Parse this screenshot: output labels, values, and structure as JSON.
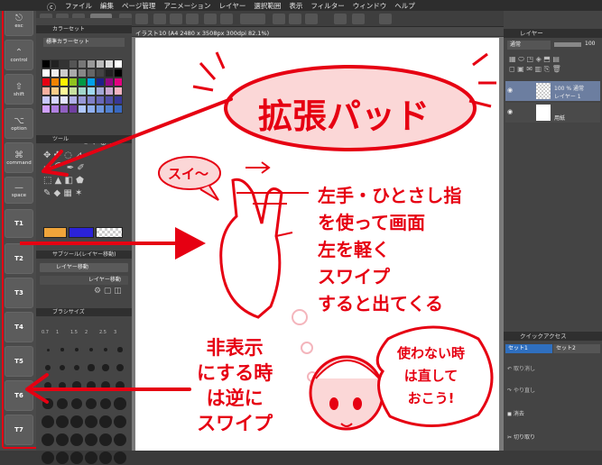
{
  "menubar": {
    "items": [
      "ファイル",
      "編集",
      "ページ管理",
      "アニメーション",
      "レイヤー",
      "選択範囲",
      "表示",
      "フィルター",
      "ウィンドウ",
      "ヘルプ"
    ]
  },
  "pad": {
    "buttons": [
      {
        "icon": "⎋",
        "label": "esc"
      },
      {
        "icon": "⌃",
        "label": "control"
      },
      {
        "icon": "⇧",
        "label": "shift"
      },
      {
        "icon": "⌥",
        "label": "option"
      },
      {
        "icon": "⌘",
        "label": "command"
      },
      {
        "icon": "—",
        "label": "space"
      },
      {
        "icon": "",
        "label": "T1"
      },
      {
        "icon": "",
        "label": "T2"
      },
      {
        "icon": "",
        "label": "T3"
      },
      {
        "icon": "",
        "label": "T4"
      },
      {
        "icon": "",
        "label": "T5"
      },
      {
        "icon": "",
        "label": "T6"
      },
      {
        "icon": "",
        "label": "T7"
      }
    ]
  },
  "palettes": {
    "color_set_tab": "カラーセット",
    "color_set_name": "標準カラーセット",
    "tool_tab": "ツール",
    "subtool_tab": "サブツール(レイヤー移動)",
    "subtool_item1": "レイヤー移動",
    "subtool_item2": "レイヤー移動",
    "brush_size_tab": "ブラシサイズ",
    "brush_sizes": [
      "0.7",
      "1",
      "1.5",
      "2",
      "2.5",
      "3"
    ]
  },
  "document": {
    "tab_title": "イラスト10 (A4 2480 x 3508px 300dpi 82.1%)"
  },
  "layers": {
    "panel_title": "レイヤー",
    "blend_mode": "通常",
    "opacity": "100",
    "layer1_meta": "100 % 通常",
    "layer1_name": "レイヤー 1",
    "paper_name": "用紙"
  },
  "quick_access": {
    "panel_title": "クイックアクセス",
    "tab1": "セット1",
    "tab2": "セット2",
    "items": [
      "取り消し",
      "やり直し",
      "消去",
      "切り取り"
    ]
  },
  "annotations": {
    "title": "拡張パッド",
    "swipe": "スイ〜",
    "instruction_lines": [
      "左手・ひとさし指",
      "を使って画面",
      "左を軽く",
      "スワイプ",
      "すると出てくる"
    ],
    "hide_lines": [
      "非表示",
      "にする時",
      "は逆に",
      "スワイプ"
    ],
    "bubble_lines": [
      "使わない時",
      "は直して",
      "おこう!"
    ]
  },
  "colors": {
    "annotation_red": "#e60012",
    "title_fill": "#fbd7d7"
  }
}
